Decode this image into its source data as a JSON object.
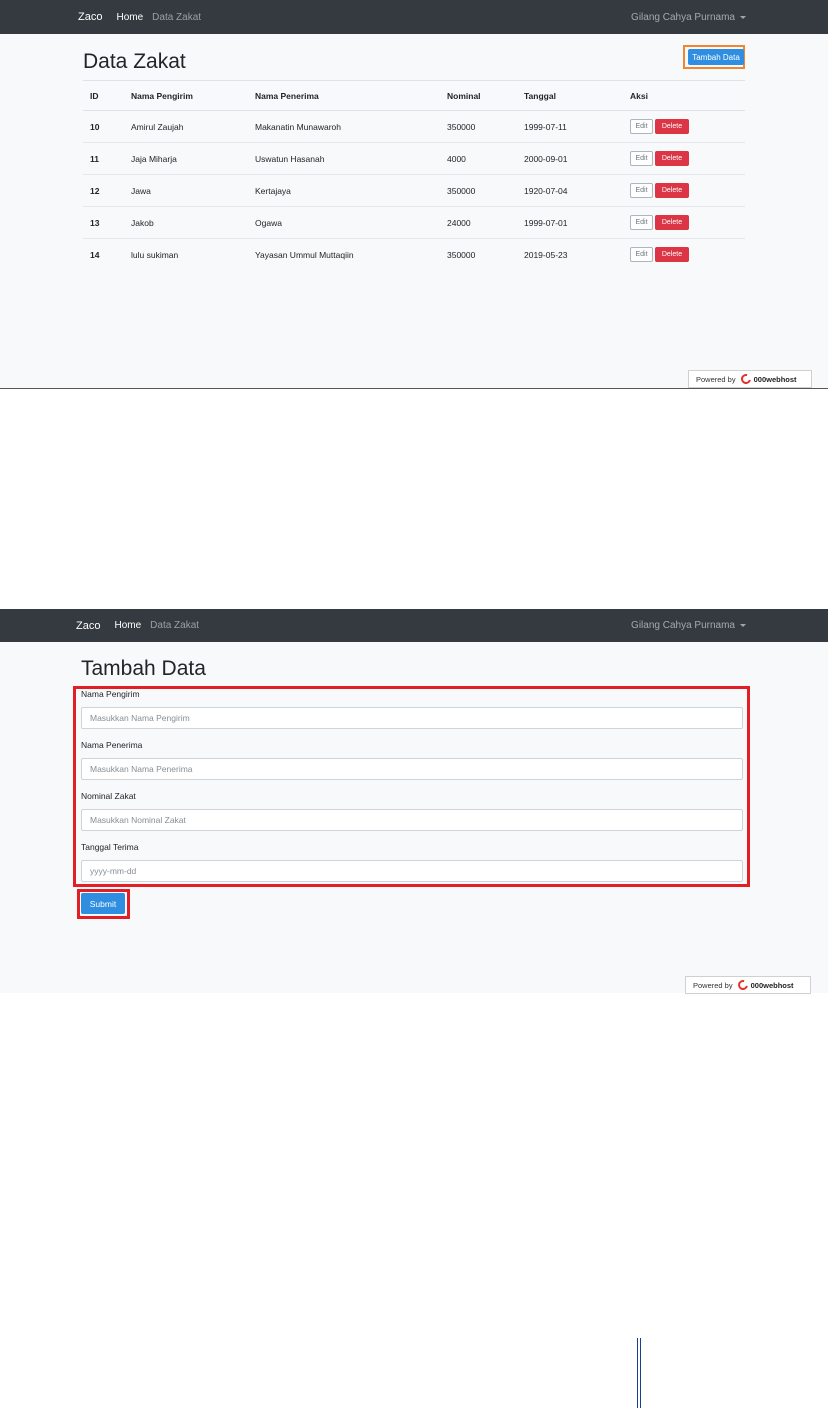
{
  "navbar": {
    "brand": "Zaco",
    "links": [
      {
        "label": "Home",
        "active": true
      },
      {
        "label": "Data Zakat",
        "active": false
      }
    ],
    "user": "Gilang Cahya Purnama"
  },
  "list_page": {
    "title": "Data Zakat",
    "add_button": "Tambah Data",
    "columns": [
      "ID",
      "Nama Pengirim",
      "Nama Penerima",
      "Nominal",
      "Tanggal",
      "Aksi"
    ],
    "rows": [
      {
        "id": "10",
        "pengirim": "Amirul Zaujah",
        "penerima": "Makanatin Munawaroh",
        "nominal": "350000",
        "tanggal": "1999-07-11"
      },
      {
        "id": "11",
        "pengirim": "Jaja Miharja",
        "penerima": "Uswatun Hasanah",
        "nominal": "4000",
        "tanggal": "2000-09-01"
      },
      {
        "id": "12",
        "pengirim": "Jawa",
        "penerima": "Kertajaya",
        "nominal": "350000",
        "tanggal": "1920-07-04"
      },
      {
        "id": "13",
        "pengirim": "Jakob",
        "penerima": "Ogawa",
        "nominal": "24000",
        "tanggal": "1999-07-01"
      },
      {
        "id": "14",
        "pengirim": "lulu sukiman",
        "penerima": "Yayasan Ummul Muttaqiin",
        "nominal": "350000",
        "tanggal": "2019-05-23"
      }
    ],
    "edit_label": "Edit",
    "delete_label": "Delete"
  },
  "form_page": {
    "title": "Tambah Data",
    "fields": [
      {
        "label": "Nama Pengirim",
        "placeholder": "Masukkan Nama Pengirim"
      },
      {
        "label": "Nama Penerima",
        "placeholder": "Masukkan Nama Penerima"
      },
      {
        "label": "Nominal Zakat",
        "placeholder": "Masukkan Nominal Zakat"
      },
      {
        "label": "Tanggal Terima",
        "placeholder": "yyyy-mm-dd"
      }
    ],
    "submit_label": "Submit"
  },
  "footer": {
    "powered_by": "Powered by",
    "host": "000webhost"
  },
  "colors": {
    "navbar": "#343a40",
    "primary": "#2f8ee0",
    "danger": "#dc3545",
    "highlight_orange": "#f0862e",
    "highlight_red": "#e41e25"
  }
}
